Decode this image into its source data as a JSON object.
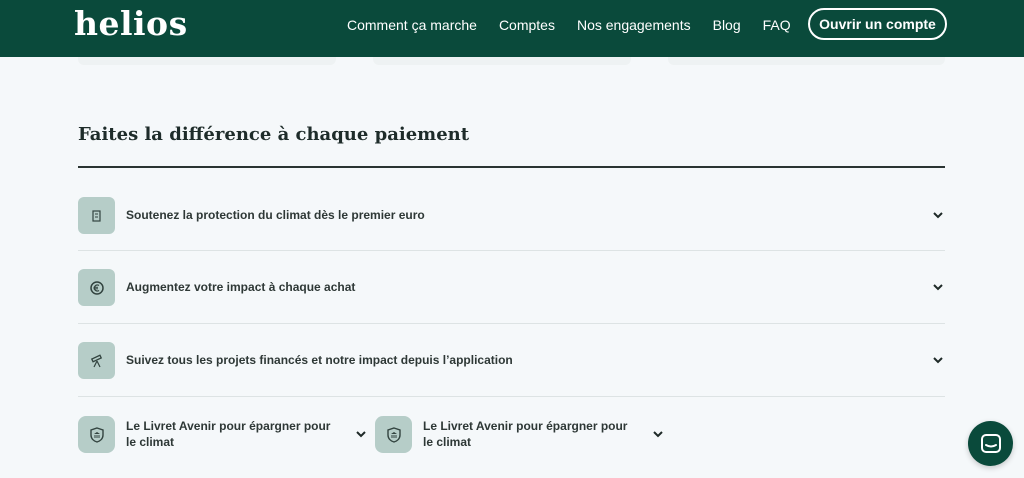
{
  "header": {
    "logo": "helios",
    "nav": [
      {
        "label": "Comment ça marche"
      },
      {
        "label": "Comptes"
      },
      {
        "label": "Nos engagements"
      },
      {
        "label": "Blog"
      },
      {
        "label": "FAQ"
      }
    ],
    "cta_label": "Ouvrir un compte"
  },
  "section": {
    "title": "Faites la différence à chaque paiement",
    "items": [
      {
        "label": "Soutenez la protection du climat dès le premier euro",
        "icon": "document-icon"
      },
      {
        "label": "Augmentez votre impact à chaque achat",
        "icon": "euro-coin-icon"
      },
      {
        "label": "Suivez tous les projets financés et notre impact depuis l’application",
        "icon": "telescope-icon"
      }
    ],
    "cards": [
      {
        "label": "Le Livret Avenir pour épargner pour le climat",
        "icon": "bank-shield-icon"
      },
      {
        "label": "Le Livret Avenir pour épargner pour le climat",
        "icon": "bank-shield-icon"
      }
    ]
  },
  "colors": {
    "brand": "#0a4a3b",
    "icon_bg": "#b6cdc8",
    "page_bg": "#f5f8fa"
  }
}
